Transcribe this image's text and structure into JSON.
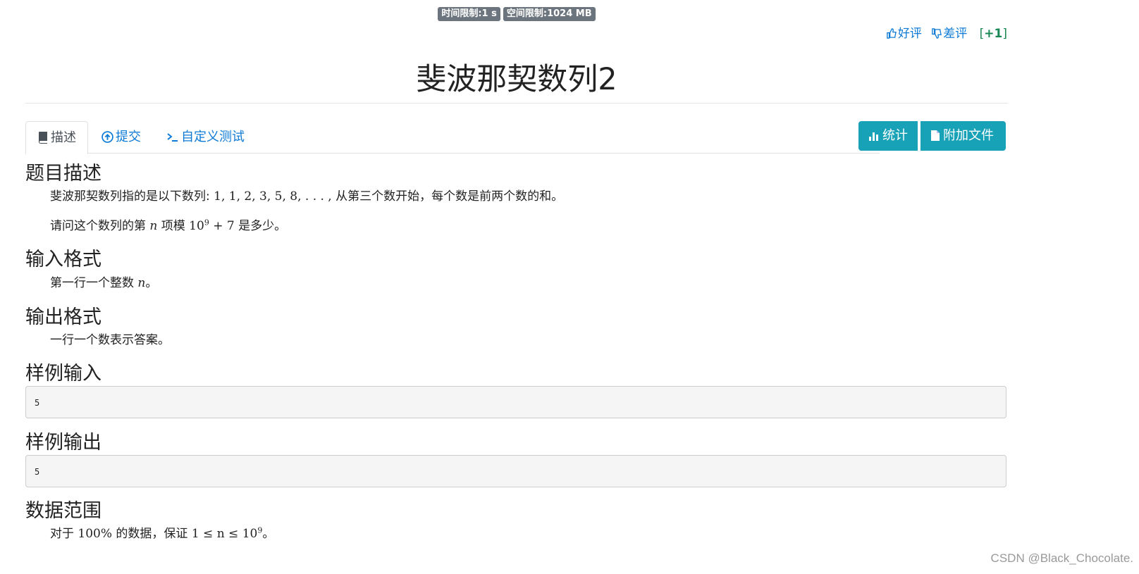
{
  "limits": {
    "time": "时间限制:1 s",
    "memory": "空间限制:1024 MB"
  },
  "votes": {
    "like": "好评",
    "dislike": "差评",
    "score_open": "[",
    "score_value": "+1",
    "score_close": "]"
  },
  "title": "斐波那契数列2",
  "tabs": [
    {
      "label": "描述",
      "icon": "book-icon",
      "active": true
    },
    {
      "label": "提交",
      "icon": "upload-circle-icon",
      "active": false
    },
    {
      "label": "自定义测试",
      "icon": "terminal-icon",
      "active": false
    }
  ],
  "actions": {
    "stats": "统计",
    "files": "附加文件"
  },
  "sections": {
    "description": {
      "heading": "题目描述",
      "p1_text": "斐波那契数列指的是以下数列: ",
      "p1_math": "1, 1, 2, 3, 5, 8, . . . ,",
      "p1_tail": " 从第三个数开始，每个数是前两个数的和。",
      "p2_a": "请问这个数列的第 ",
      "p2_n": "n",
      "p2_b": " 项模 ",
      "p2_base": "10",
      "p2_exp": "9",
      "p2_plus": " + 7",
      "p2_c": " 是多少。"
    },
    "input": {
      "heading": "输入格式",
      "text": "第一行一个整数 ",
      "n": "n",
      "end": "。"
    },
    "output": {
      "heading": "输出格式",
      "text": "一行一个数表示答案。"
    },
    "sample_input": {
      "heading": "样例输入",
      "value": "5"
    },
    "sample_output": {
      "heading": "样例输出",
      "value": "5"
    },
    "range": {
      "heading": "数据范围",
      "a": "对于 ",
      "pct": "100%",
      "b": " 的数据，保证 ",
      "expr": "1 ≤ n ≤ ",
      "base": "10",
      "exp": "9",
      "end": "。"
    }
  },
  "watermark": "CSDN @Black_Chocolate.",
  "colors": {
    "link": "#0d7bd6",
    "button": "#17a2b8",
    "badge": "#6c757d",
    "score": "#198754"
  }
}
